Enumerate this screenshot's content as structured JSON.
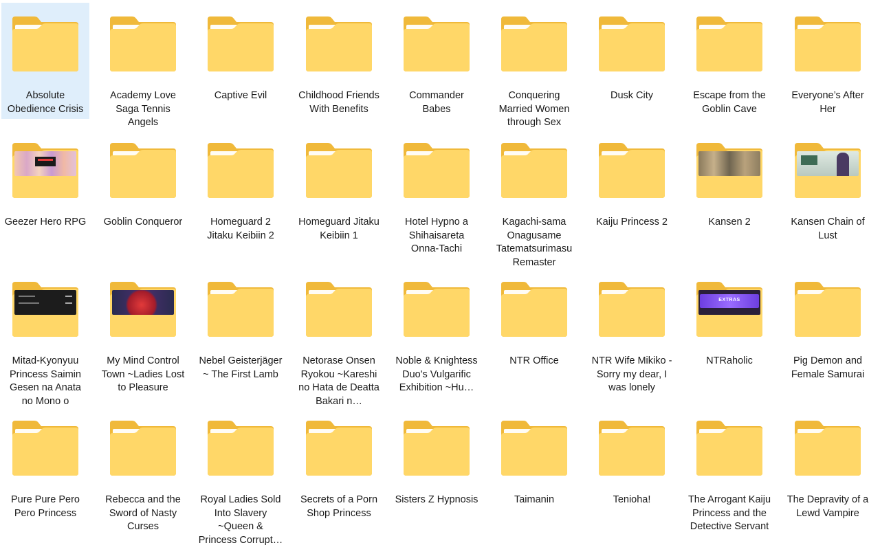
{
  "window": {
    "view": "Large icons"
  },
  "colors": {
    "folder_back": "#F0B93A",
    "folder_front": "#FFD768",
    "folder_paper": "#FFFFFF",
    "selection": "#DFEEFB"
  },
  "folders": [
    {
      "name": "Absolute Obedience Crisis",
      "selected": true
    },
    {
      "name": "Academy Love Saga Tennis Angels"
    },
    {
      "name": "Captive Evil"
    },
    {
      "name": "Childhood Friends With Benefits"
    },
    {
      "name": "Commander Babes"
    },
    {
      "name": "Conquering Married Women through Sex"
    },
    {
      "name": "Dusk City"
    },
    {
      "name": "Escape from the Goblin Cave"
    },
    {
      "name": "Everyone’s After Her"
    },
    {
      "name": "Geezer Hero RPG",
      "thumb": "collage"
    },
    {
      "name": "Goblin Conqueror"
    },
    {
      "name": "Homeguard 2 Jitaku Keibiin 2"
    },
    {
      "name": "Homeguard Jitaku Keibiin 1"
    },
    {
      "name": "Hotel Hypno a Shihaisareta Onna-Tachi"
    },
    {
      "name": "Kagachi-sama Onagusame Tatematsurimasu Remaster"
    },
    {
      "name": "Kaiju Princess 2"
    },
    {
      "name": "Kansen 2",
      "thumb": "scene"
    },
    {
      "name": "Kansen Chain of Lust",
      "thumb": "classroom"
    },
    {
      "name": "Mitad-Kyonyuu Princess Saimin Gesen na Anata no Mono o",
      "thumb": "dark-menu"
    },
    {
      "name": "My Mind Control Town ~Ladies Lost to Pleasure",
      "thumb": "red-art"
    },
    {
      "name": "Nebel Geisterjäger ~ The First Lamb"
    },
    {
      "name": "Netorase Onsen Ryokou ~Kareshi no Hata de Deatta Bakari n…"
    },
    {
      "name": "Noble & Knightess Duo's Vulgarific Exhibition ~Hu…"
    },
    {
      "name": "NTR Office"
    },
    {
      "name": "NTR Wife Mikiko - Sorry my dear, I was lonely"
    },
    {
      "name": "NTRaholic",
      "thumb": "extras",
      "thumb_text": "EXTRAS"
    },
    {
      "name": "Pig Demon and Female Samurai"
    },
    {
      "name": "Pure Pure Pero Pero Princess"
    },
    {
      "name": "Rebecca and the Sword of Nasty Curses"
    },
    {
      "name": "Royal Ladies Sold Into Slavery ~Queen & Princess Corrupt…"
    },
    {
      "name": "Secrets of a Porn Shop Princess"
    },
    {
      "name": "Sisters Z Hypnosis"
    },
    {
      "name": "Taimanin"
    },
    {
      "name": "Tenioha!"
    },
    {
      "name": "The Arrogant Kaiju Princess and the Detective Servant"
    },
    {
      "name": "The Depravity of a Lewd Vampire"
    }
  ]
}
